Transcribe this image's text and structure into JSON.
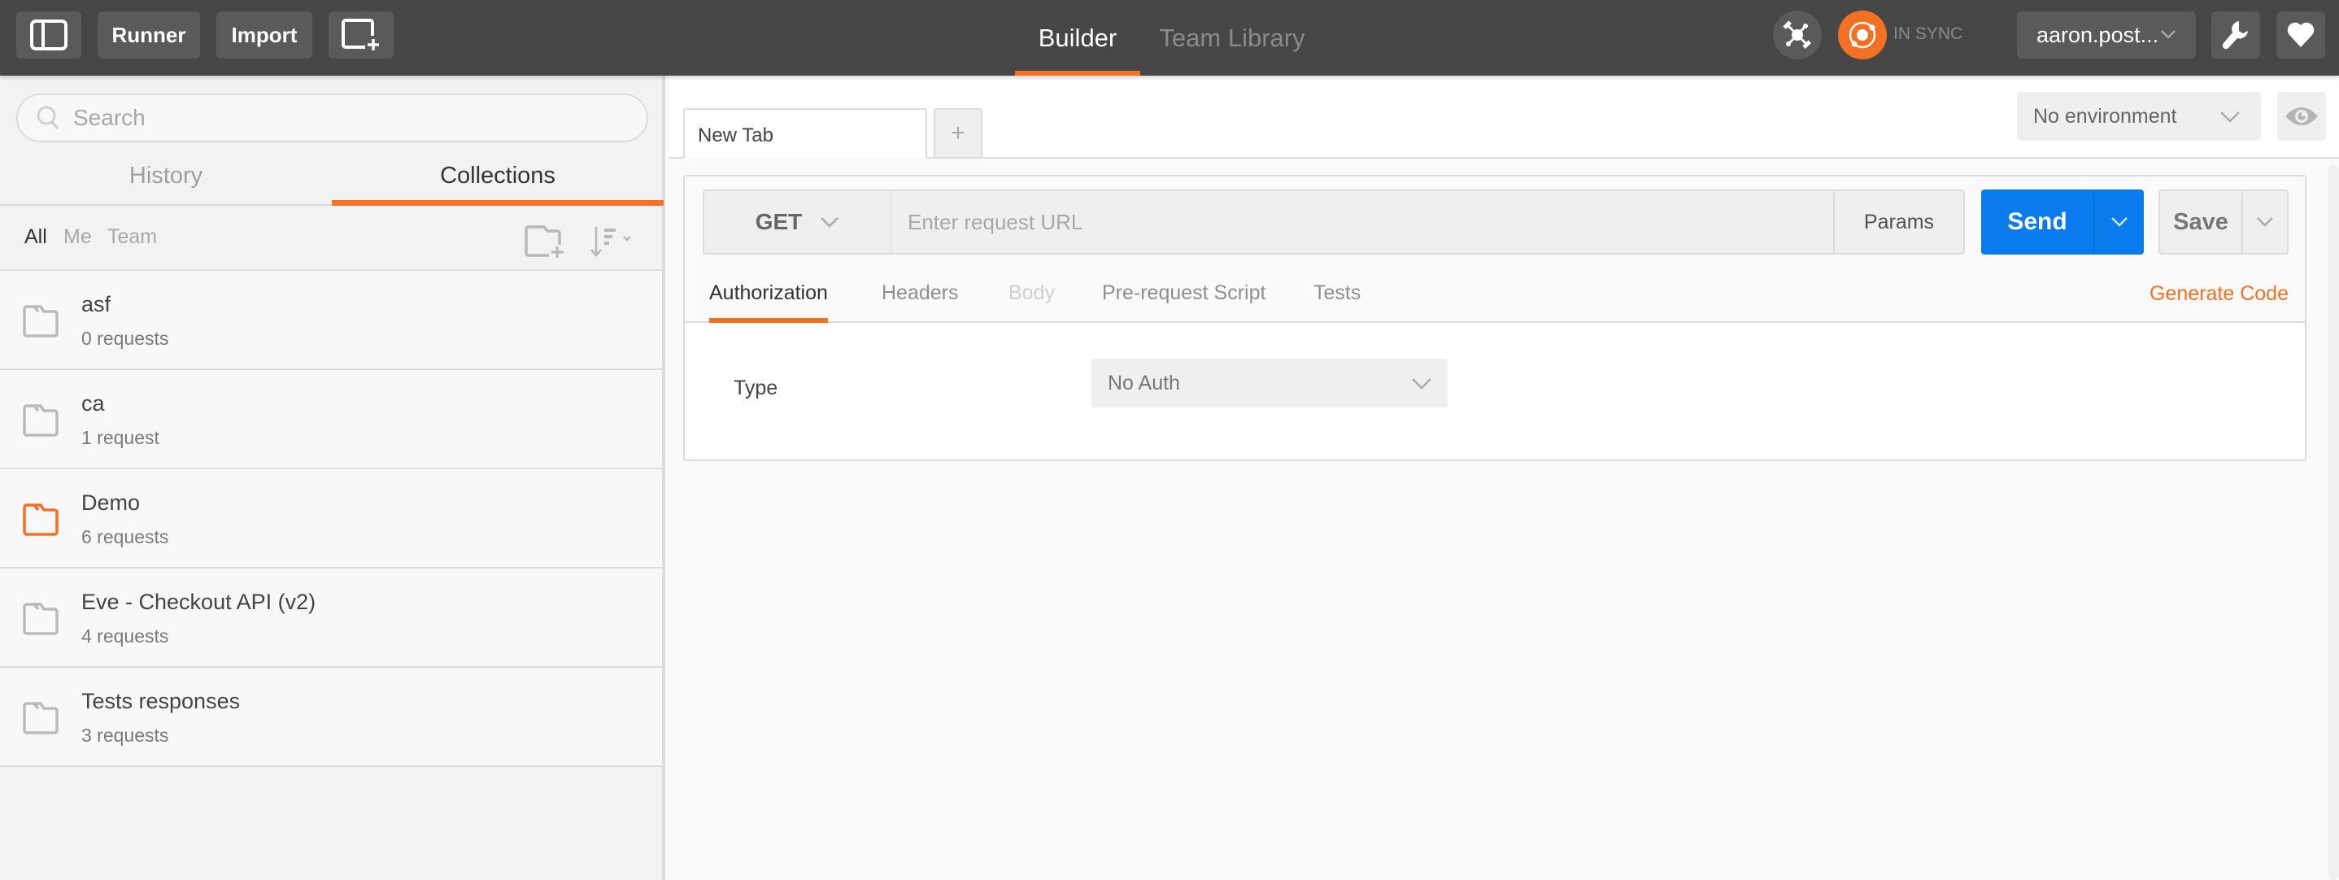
{
  "header": {
    "sidebar_toggle_icon": "sidebar-toggle-icon",
    "runner_label": "Runner",
    "import_label": "Import",
    "new_window_icon": "new-window-icon",
    "nav_tabs": [
      {
        "label": "Builder",
        "active": true
      },
      {
        "label": "Team Library",
        "active": false
      }
    ],
    "interceptor_icon": "satellite-icon",
    "sync_icon": "sync-icon",
    "sync_status": "IN SYNC",
    "user_label": "aaron.post...",
    "settings_icon": "wrench-icon",
    "favorite_icon": "heart-icon"
  },
  "sidebar": {
    "search_placeholder": "Search",
    "tabs": [
      {
        "label": "History",
        "active": false
      },
      {
        "label": "Collections",
        "active": true
      }
    ],
    "filters": [
      {
        "label": "All",
        "active": true
      },
      {
        "label": "Me",
        "active": false
      },
      {
        "label": "Team",
        "active": false
      }
    ],
    "new_collection_icon": "folder-plus-icon",
    "sort_icon": "sort-icon",
    "collections": [
      {
        "name": "asf",
        "count": "0 requests",
        "highlighted": false
      },
      {
        "name": "ca",
        "count": "1 request",
        "highlighted": false
      },
      {
        "name": "Demo",
        "count": "6 requests",
        "highlighted": true
      },
      {
        "name": "Eve - Checkout API (v2)",
        "count": "4 requests",
        "highlighted": false
      },
      {
        "name": "Tests responses",
        "count": "3 requests",
        "highlighted": false
      }
    ]
  },
  "main": {
    "request_tab_label": "New Tab",
    "add_tab_label": "+",
    "environment": "No environment",
    "request": {
      "method": "GET",
      "url_value": "",
      "url_placeholder": "Enter request URL",
      "params_label": "Params",
      "send_label": "Send",
      "save_label": "Save"
    },
    "subtabs": [
      {
        "label": "Authorization",
        "state": "active"
      },
      {
        "label": "Headers",
        "state": "inactive"
      },
      {
        "label": "Body",
        "state": "disabled"
      },
      {
        "label": "Pre-request Script",
        "state": "inactive"
      },
      {
        "label": "Tests",
        "state": "inactive"
      }
    ],
    "generate_code_label": "Generate Code",
    "auth": {
      "type_label": "Type",
      "type_value": "No Auth"
    }
  },
  "colors": {
    "accent_orange": "#f47023",
    "send_blue": "#097bed",
    "header_bg": "#464646"
  }
}
